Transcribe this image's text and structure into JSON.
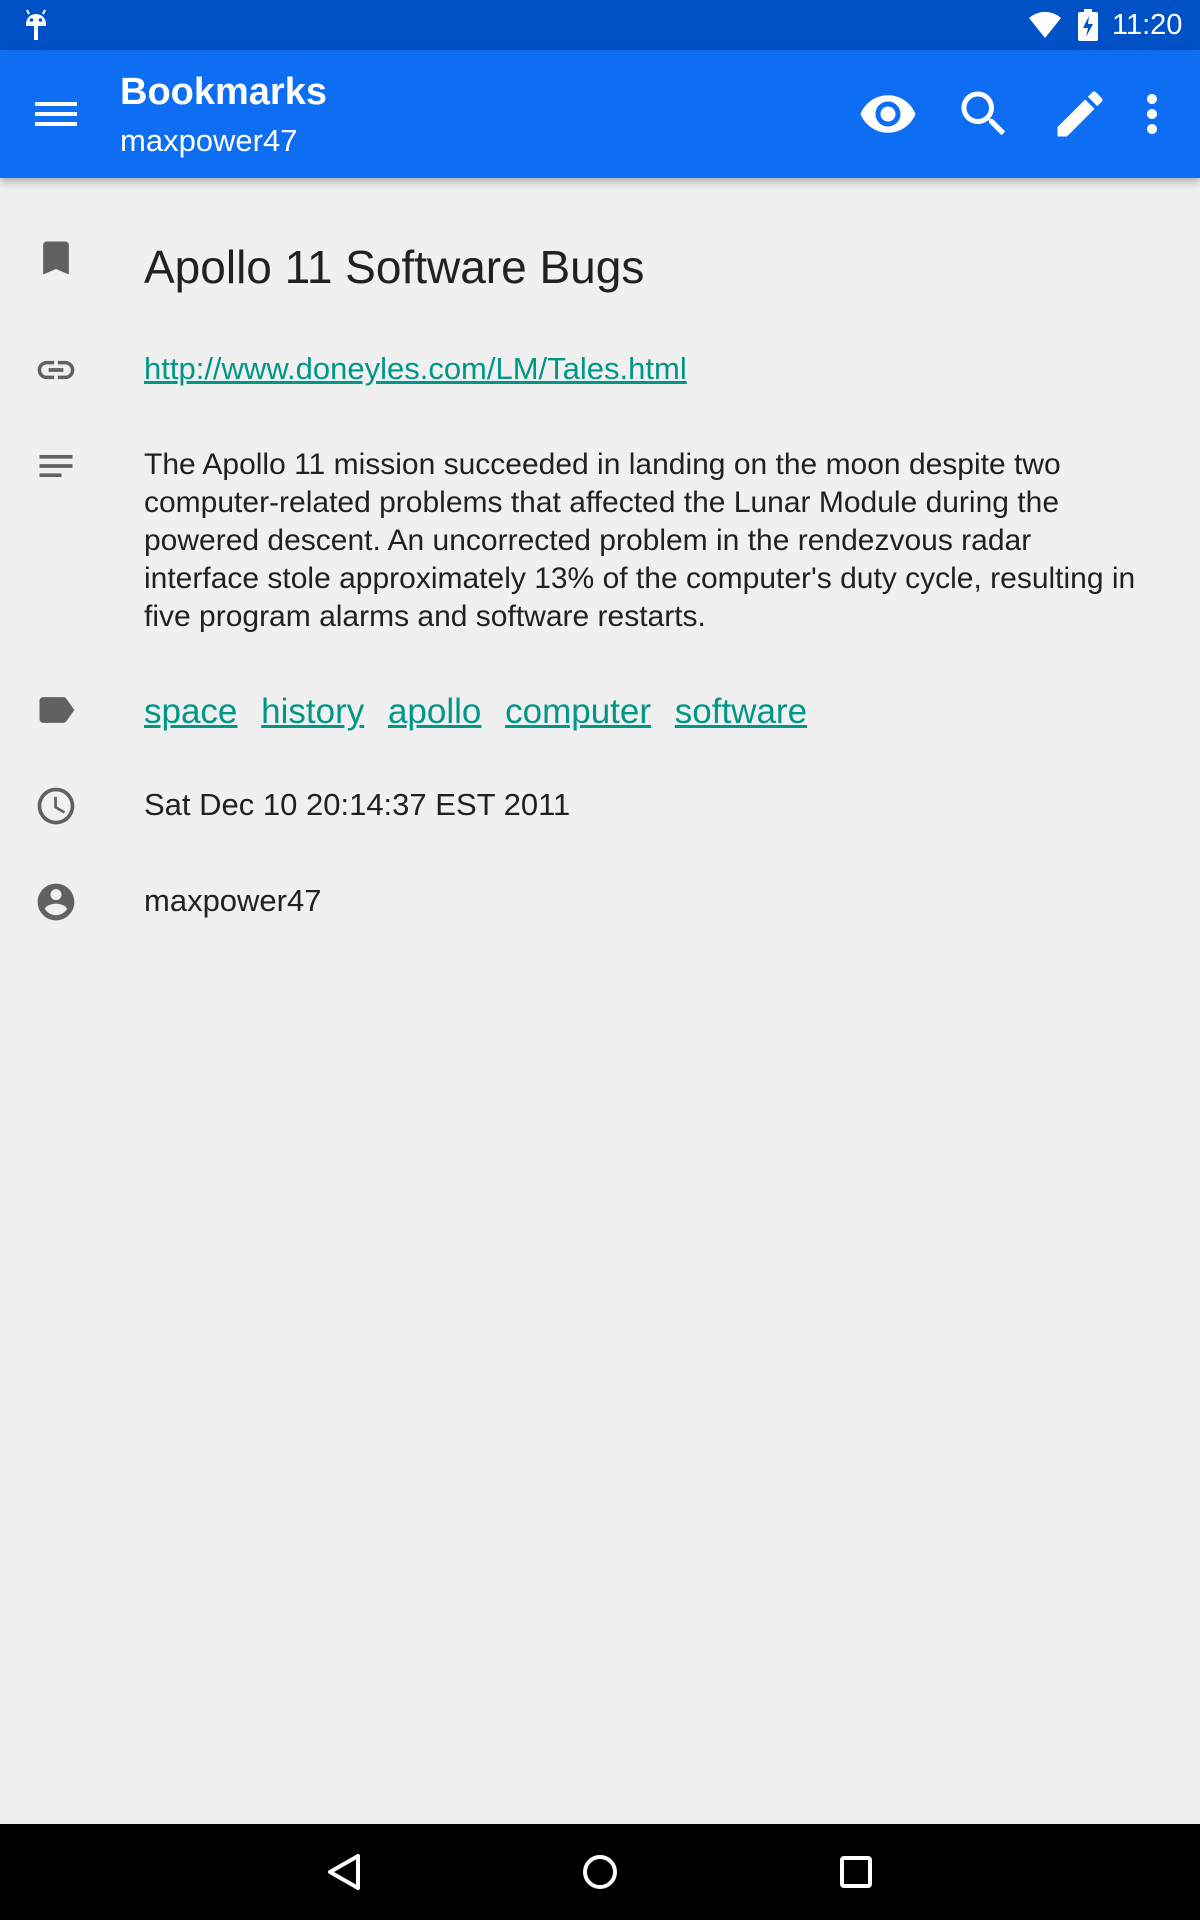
{
  "status_bar": {
    "time": "11:20",
    "icons": [
      "android-icon",
      "wifi-icon",
      "battery-charging-icon"
    ]
  },
  "app_bar": {
    "title": "Bookmarks",
    "subtitle": "maxpower47",
    "background_color": "#0d6ef4",
    "actions": [
      "menu-icon",
      "eye-icon",
      "search-icon",
      "edit-icon",
      "more-vert-icon"
    ]
  },
  "bookmark": {
    "title": "Apollo 11 Software Bugs",
    "url": "http://www.doneyles.com/LM/Tales.html",
    "description": "The Apollo 11 mission succeeded in landing on the moon despite two computer-related problems that affected the Lunar Module during the powered descent. An uncorrected problem in the rendezvous radar interface stole approximately 13% of the computer's duty cycle, resulting in five program alarms and software restarts.",
    "tags": [
      "space",
      "history",
      "apollo",
      "computer",
      "software"
    ],
    "date": "Sat Dec 10 20:14:37 EST 2011",
    "owner": "maxpower47",
    "link_color": "#009688"
  },
  "icons": {
    "title": "bookmark-icon",
    "url": "link-icon",
    "description": "notes-icon",
    "tags": "label-icon",
    "date": "clock-icon",
    "owner": "account-circle-icon"
  },
  "nav_bar": [
    "back-icon",
    "home-icon",
    "recents-icon"
  ]
}
